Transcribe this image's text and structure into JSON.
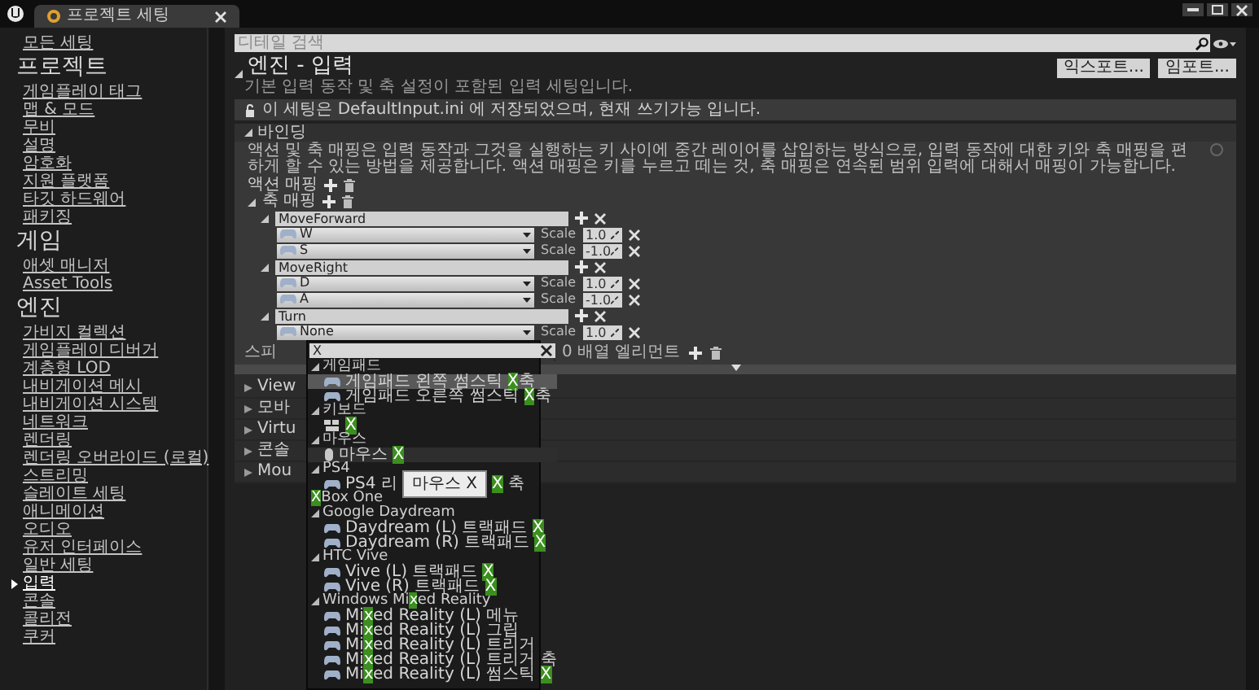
{
  "window": {
    "tab": "프로젝트 세팅"
  },
  "sidebar": {
    "items": [
      {
        "kind": "link",
        "label": "모든 세팅",
        "selected": false
      },
      {
        "kind": "header",
        "label": "프로젝트"
      },
      {
        "kind": "link",
        "label": "게임플레이 태그",
        "selected": false
      },
      {
        "kind": "link",
        "label": "맵 & 모드",
        "selected": false
      },
      {
        "kind": "link",
        "label": "무비",
        "selected": false
      },
      {
        "kind": "link",
        "label": "설명",
        "selected": false
      },
      {
        "kind": "link",
        "label": "암호화",
        "selected": false
      },
      {
        "kind": "link",
        "label": "지원 플랫폼",
        "selected": false
      },
      {
        "kind": "link",
        "label": "타깃 하드웨어",
        "selected": false
      },
      {
        "kind": "link",
        "label": "패키징",
        "selected": false
      },
      {
        "kind": "header",
        "label": "게임"
      },
      {
        "kind": "link",
        "label": "애셋 매니저",
        "selected": false
      },
      {
        "kind": "link",
        "label": "Asset Tools",
        "selected": false
      },
      {
        "kind": "header",
        "label": "엔진"
      },
      {
        "kind": "link",
        "label": "가비지 컬렉션",
        "selected": false
      },
      {
        "kind": "link",
        "label": "게임플레이 디버거",
        "selected": false
      },
      {
        "kind": "link",
        "label": "계층형 LOD",
        "selected": false
      },
      {
        "kind": "link",
        "label": "내비게이션 메시",
        "selected": false
      },
      {
        "kind": "link",
        "label": "내비게이션 시스템",
        "selected": false
      },
      {
        "kind": "link",
        "label": "네트워크",
        "selected": false
      },
      {
        "kind": "link",
        "label": "렌더링",
        "selected": false
      },
      {
        "kind": "link",
        "label": "렌더링 오버라이드 (로컬)",
        "selected": false
      },
      {
        "kind": "link",
        "label": "스트리밍",
        "selected": false
      },
      {
        "kind": "link",
        "label": "슬레이트 세팅",
        "selected": false
      },
      {
        "kind": "link",
        "label": "애니메이션",
        "selected": false
      },
      {
        "kind": "link",
        "label": "오디오",
        "selected": false
      },
      {
        "kind": "link",
        "label": "유저 인터페이스",
        "selected": false
      },
      {
        "kind": "link",
        "label": "일반 세팅",
        "selected": false
      },
      {
        "kind": "link",
        "label": "입력",
        "selected": true
      },
      {
        "kind": "link",
        "label": "콘솔",
        "selected": false
      },
      {
        "kind": "link",
        "label": "콜리전",
        "selected": false
      },
      {
        "kind": "link",
        "label": "쿠커",
        "selected": false
      }
    ]
  },
  "search": {
    "placeholder": "디테일 검색"
  },
  "page": {
    "title": "엔진 - 입력",
    "subtitle": "기본 입력 동작 및 축 설정이 포함된 입력 세팅입니다.",
    "buttons": [
      "익스포트...",
      "임포트..."
    ],
    "notice": "이 세팅은 DefaultInput.ini 에 저장되었으며, 현재 쓰기가능 입니다."
  },
  "bindings": {
    "title": "바인딩",
    "expanded": true,
    "description": "액션 및 축 매핑은 입력 동작과 그것을 실행하는 키 사이에 중간 레이어를 삽입하는 방식으로, 입력 동작에 대한 키와 축 매핑을 편하게 할 수 있는 방법을 제공합니다. 액션 매핑은 키를 누르고 떼는 것, 축 매핑은 연속된 범위 입력에 대해서 매핑이 가능합니다.",
    "action_mappings": {
      "label": "액션 매핑"
    },
    "axis_mappings": {
      "label": "축 매핑",
      "expanded": true,
      "children": [
        {
          "name": "MoveForward",
          "expanded": true,
          "children": [
            {
              "key": "W",
              "scale_label": "Scale",
              "scale": "1.0"
            },
            {
              "key": "S",
              "scale_label": "Scale",
              "scale": "-1.0"
            }
          ]
        },
        {
          "name": "MoveRight",
          "expanded": true,
          "children": [
            {
              "key": "D",
              "scale_label": "Scale",
              "scale": "1.0"
            },
            {
              "key": "A",
              "scale_label": "Scale",
              "scale": "-1.0"
            }
          ]
        },
        {
          "name": "Turn",
          "expanded": true,
          "children": [
            {
              "key": "None",
              "scale_label": "Scale",
              "scale": "1.0",
              "open": true
            }
          ]
        }
      ]
    },
    "array_row": {
      "label": "스피",
      "value": "0 배열 엘리먼트"
    },
    "collapsed_sections": [
      "View",
      "모바",
      "Virtu",
      "콘솔",
      "Mou"
    ]
  },
  "key_picker": {
    "query": "X",
    "tooltip": "마우스 X",
    "groups": [
      {
        "expanded": true,
        "label": [
          {
            "text": "게임패드",
            "match": false
          }
        ],
        "items": [
          {
            "kind": "gamepad",
            "selected": true,
            "hovered": false,
            "parts": [
              {
                "text": "게임패드 왼쪽 썸스틱 ",
                "match": false
              },
              {
                "text": "X",
                "match": true
              },
              {
                "text": "축",
                "match": false
              }
            ]
          },
          {
            "kind": "gamepad",
            "selected": false,
            "hovered": false,
            "parts": [
              {
                "text": "게임패드 오른쪽 썸스틱 ",
                "match": false
              },
              {
                "text": "X",
                "match": true
              },
              {
                "text": "축",
                "match": false
              }
            ]
          }
        ]
      },
      {
        "expanded": true,
        "label": [
          {
            "text": "키보드",
            "match": false
          }
        ],
        "items": [
          {
            "kind": "keyboard",
            "selected": false,
            "hovered": false,
            "parts": [
              {
                "text": "X",
                "match": true
              }
            ]
          }
        ]
      },
      {
        "expanded": true,
        "label": [
          {
            "text": "마우스",
            "match": false
          }
        ],
        "items": [
          {
            "kind": "mouse",
            "selected": false,
            "hovered": true,
            "parts": [
              {
                "text": "마우스 ",
                "match": false
              },
              {
                "text": "X",
                "match": true
              }
            ]
          }
        ]
      },
      {
        "expanded": true,
        "label": [
          {
            "text": "PS4",
            "match": false
          }
        ],
        "items": [
          {
            "kind": "gamepad",
            "selected": false,
            "hovered": false,
            "parts": [
              {
                "text": "PS4 리",
                "match": false
              }
            ],
            "parts_after_tooltip": [
              {
                "text": "X",
                "match": true
              },
              {
                "text": " 축",
                "match": false
              }
            ]
          }
        ]
      },
      {
        "expanded": false,
        "label": [
          {
            "text": "X",
            "match": true
          },
          {
            "text": "Box One",
            "match": false
          }
        ]
      },
      {
        "expanded": true,
        "label": [
          {
            "text": "Google Daydream",
            "match": false
          }
        ],
        "items": [
          {
            "kind": "gamepad",
            "selected": false,
            "hovered": false,
            "parts": [
              {
                "text": "Daydream (L) 트랙패드 ",
                "match": false
              },
              {
                "text": "X",
                "match": true
              }
            ]
          },
          {
            "kind": "gamepad",
            "selected": false,
            "hovered": false,
            "parts": [
              {
                "text": "Daydream (R) 트랙패드 ",
                "match": false
              },
              {
                "text": "X",
                "match": true
              }
            ]
          }
        ]
      },
      {
        "expanded": true,
        "label": [
          {
            "text": "HTC Vive",
            "match": false
          }
        ],
        "items": [
          {
            "kind": "gamepad",
            "selected": false,
            "hovered": false,
            "parts": [
              {
                "text": "Vive (L) 트랙패드 ",
                "match": false
              },
              {
                "text": "X",
                "match": true
              }
            ]
          },
          {
            "kind": "gamepad",
            "selected": false,
            "hovered": false,
            "parts": [
              {
                "text": "Vive (R) 트랙패드 ",
                "match": false
              },
              {
                "text": "X",
                "match": true
              }
            ]
          }
        ]
      },
      {
        "expanded": true,
        "label": [
          {
            "text": "Windows Mi",
            "match": false
          },
          {
            "text": "x",
            "match": true
          },
          {
            "text": "ed Reality",
            "match": false
          }
        ],
        "items": [
          {
            "kind": "gamepad",
            "selected": false,
            "hovered": false,
            "parts": [
              {
                "text": "Mi",
                "match": false
              },
              {
                "text": "x",
                "match": true
              },
              {
                "text": "ed Reality (L) 메뉴",
                "match": false
              }
            ]
          },
          {
            "kind": "gamepad",
            "selected": false,
            "hovered": false,
            "parts": [
              {
                "text": "Mi",
                "match": false
              },
              {
                "text": "x",
                "match": true
              },
              {
                "text": "ed Reality (L) 그립",
                "match": false
              }
            ]
          },
          {
            "kind": "gamepad",
            "selected": false,
            "hovered": false,
            "parts": [
              {
                "text": "Mi",
                "match": false
              },
              {
                "text": "x",
                "match": true
              },
              {
                "text": "ed Reality (L) 트리거",
                "match": false
              }
            ]
          },
          {
            "kind": "gamepad",
            "selected": false,
            "hovered": false,
            "parts": [
              {
                "text": "Mi",
                "match": false
              },
              {
                "text": "x",
                "match": true
              },
              {
                "text": "ed Reality (L) 트리거 축",
                "match": false
              }
            ]
          },
          {
            "kind": "gamepad",
            "selected": false,
            "hovered": false,
            "parts": [
              {
                "text": "Mi",
                "match": false
              },
              {
                "text": "x",
                "match": true
              },
              {
                "text": "ed Reality (L) 썸스틱 ",
                "match": false
              },
              {
                "text": "X",
                "match": true
              }
            ]
          }
        ]
      }
    ]
  }
}
